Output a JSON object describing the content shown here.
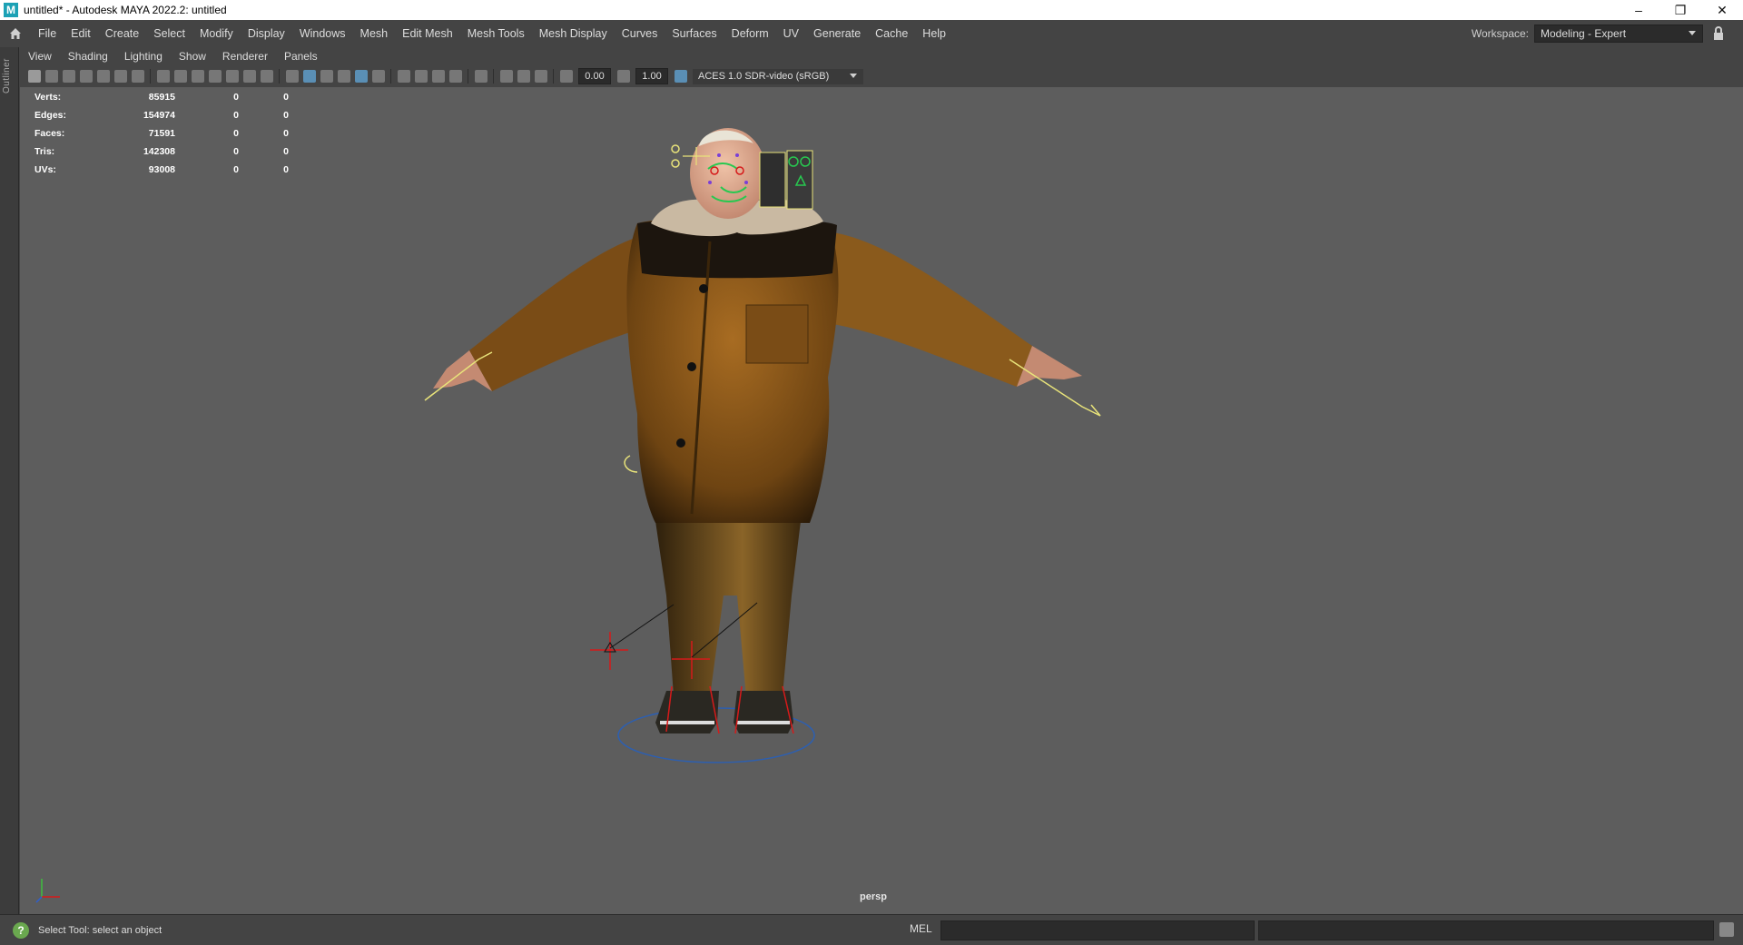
{
  "window": {
    "title": "untitled* - Autodesk MAYA 2022.2: untitled",
    "app_icon": "M",
    "controls": {
      "minimize": "–",
      "maximize": "❐",
      "close": "✕"
    }
  },
  "menubar": {
    "items": [
      "File",
      "Edit",
      "Create",
      "Select",
      "Modify",
      "Display",
      "Windows",
      "Mesh",
      "Edit Mesh",
      "Mesh Tools",
      "Mesh Display",
      "Curves",
      "Surfaces",
      "Deform",
      "UV",
      "Generate",
      "Cache",
      "Help"
    ],
    "workspace_label": "Workspace:",
    "workspace_value": "Modeling - Expert"
  },
  "outliner": {
    "label": "Outliner"
  },
  "panel_menu": [
    "View",
    "Shading",
    "Lighting",
    "Show",
    "Renderer",
    "Panels"
  ],
  "toolbar": {
    "exposure": "0.00",
    "gamma": "1.00",
    "color_management": "ACES 1.0 SDR-video (sRGB)"
  },
  "hud": {
    "rows": [
      {
        "label": "Verts:",
        "value": "85915",
        "a": "0",
        "b": "0"
      },
      {
        "label": "Edges:",
        "value": "154974",
        "a": "0",
        "b": "0"
      },
      {
        "label": "Faces:",
        "value": "71591",
        "a": "0",
        "b": "0"
      },
      {
        "label": "Tris:",
        "value": "142308",
        "a": "0",
        "b": "0"
      },
      {
        "label": "UVs:",
        "value": "93008",
        "a": "0",
        "b": "0"
      }
    ]
  },
  "viewport": {
    "camera": "persp"
  },
  "statusbar": {
    "help_text": "Select Tool: select an object",
    "mel_label": "MEL"
  },
  "colors": {
    "viewport_bg": "#5d5d5d",
    "ui_bg": "#444444",
    "jacket": "#8a5a1c",
    "pants": "#7a5525",
    "control_yellow": "#e8e37a",
    "control_red": "#d61a1a",
    "control_blue": "#2d5fb0"
  }
}
